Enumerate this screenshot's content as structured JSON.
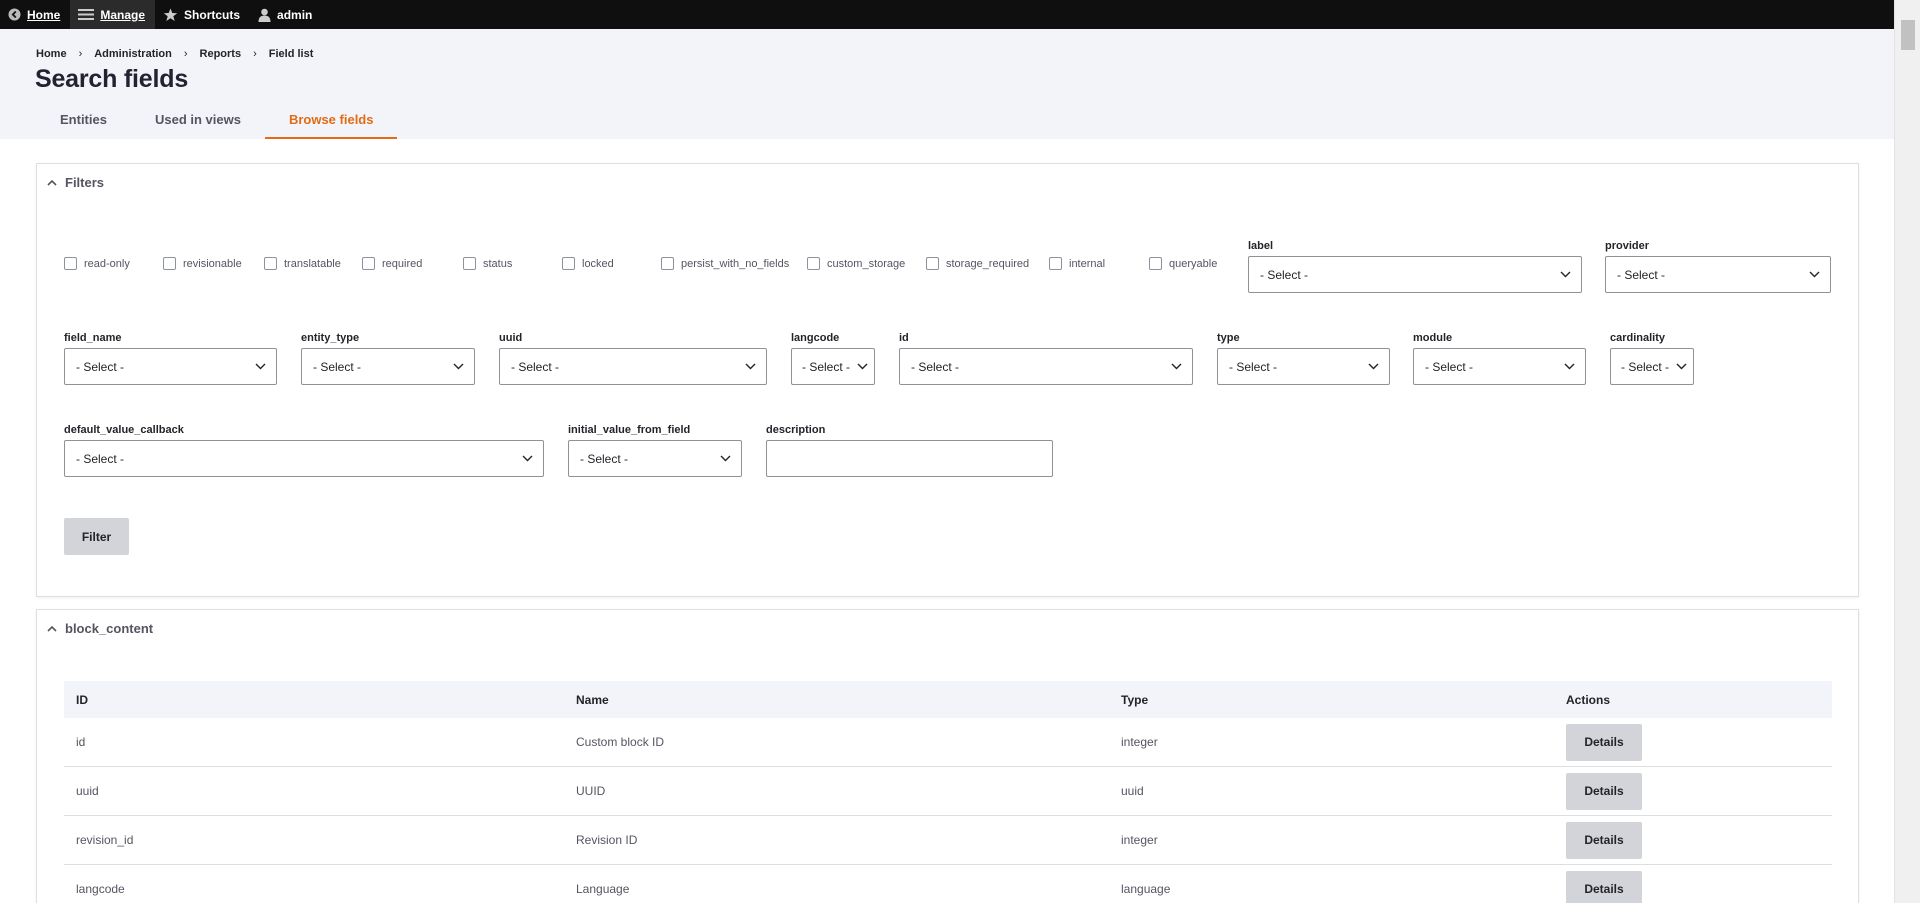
{
  "toolbar": {
    "home": "Home",
    "manage": "Manage",
    "shortcuts": "Shortcuts",
    "user": "admin"
  },
  "breadcrumb": [
    "Home",
    "Administration",
    "Reports",
    "Field list"
  ],
  "page_title": "Search fields",
  "tabs": [
    {
      "label": "Entities"
    },
    {
      "label": "Used in views"
    },
    {
      "label": "Browse fields"
    }
  ],
  "filters": {
    "title": "Filters",
    "checkboxes": [
      "read-only",
      "revisionable",
      "translatable",
      "required",
      "status",
      "locked",
      "persist_with_no_fields",
      "custom_storage",
      "storage_required",
      "internal",
      "queryable"
    ],
    "select_placeholder": "- Select -",
    "label_field": "label",
    "provider_field": "provider",
    "field_name": "field_name",
    "entity_type": "entity_type",
    "uuid": "uuid",
    "langcode": "langcode",
    "id": "id",
    "type": "type",
    "module": "module",
    "cardinality": "cardinality",
    "cardinality_value": "- Select -",
    "langcode_value": "- Select -",
    "default_value_callback": "default_value_callback",
    "initial_value_from_field": "initial_value_from_field",
    "description": "description",
    "description_value": "",
    "filter_button": "Filter"
  },
  "block_content": {
    "title": "block_content",
    "headers": [
      "ID",
      "Name",
      "Type",
      "Actions"
    ],
    "rows": [
      {
        "id": "id",
        "name": "Custom block ID",
        "type": "integer",
        "action": "Details"
      },
      {
        "id": "uuid",
        "name": "UUID",
        "type": "uuid",
        "action": "Details"
      },
      {
        "id": "revision_id",
        "name": "Revision ID",
        "type": "integer",
        "action": "Details"
      },
      {
        "id": "langcode",
        "name": "Language",
        "type": "language",
        "action": "Details"
      }
    ]
  }
}
